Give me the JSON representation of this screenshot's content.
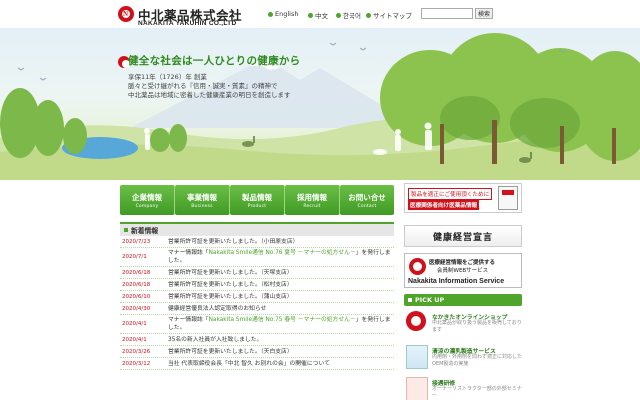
{
  "header": {
    "logo_mark": "N",
    "logo_ja": "中北薬品株式会社",
    "logo_en": "NAKAKITA YAKUHIN CO.,LTD",
    "languages": [
      "English",
      "中文",
      "한국어",
      "サイトマップ"
    ],
    "search_button": "検索",
    "accent_color": "#4fa42a",
    "brand_color": "#d0101a"
  },
  "hero": {
    "headline": "健全な社会は一人ひとりの健康から",
    "line1": "享保11年（1726）年 創業",
    "line2": "脈々と受け継がれる『信用・誠実・質素』の精神で",
    "line3": "中北薬品は地域に密着した健康産業の明日を創造します"
  },
  "nav": [
    {
      "ja": "企業情報",
      "en": "Company"
    },
    {
      "ja": "事業情報",
      "en": "Business"
    },
    {
      "ja": "製品情報",
      "en": "Product"
    },
    {
      "ja": "採用情報",
      "en": "Recruit"
    },
    {
      "ja": "お問い合せ",
      "en": "Contact"
    }
  ],
  "news": {
    "title": "新着情報",
    "items": [
      {
        "date": "2020/7/23",
        "text": "営業所許可証を更新いたしました。（小田原支店）"
      },
      {
        "date": "2020/7/1",
        "text_pre": "マナー情報誌「",
        "highlight": "Nakakita Smile通信 No.76 夏号 －マナーの処方せん－",
        "text_post": "」を発行しました。"
      },
      {
        "date": "2020/6/18",
        "text": "営業所許可証を更新いたしました。（天塚支店）"
      },
      {
        "date": "2020/6/18",
        "text": "営業所許可証を更新いたしました。（松村支店）"
      },
      {
        "date": "2020/6/10",
        "text": "営業所許可証を更新いたしました。（蒲山支店）"
      },
      {
        "date": "2020/4/30",
        "text": "健康経営優良法人認定取得のお知らせ"
      },
      {
        "date": "2020/4/1",
        "text_pre": "マナー情報誌「",
        "highlight": "Nakakita Smile通信 No.75 春号 －マナーの処方せん－",
        "text_post": "」を発行しました。"
      },
      {
        "date": "2020/4/1",
        "text": "35名の新入社員が入社致しました。"
      },
      {
        "date": "2020/3/26",
        "text": "営業所許可証を更新いたしました。（天白支店）"
      },
      {
        "date": "2020/3/12",
        "text": "当社 代表取締役会長「中北 智久 お別れの会」の開催について"
      }
    ]
  },
  "side": {
    "banner_tag1": "製品を適正にご使用頂くために",
    "banner_tag2": "医療関係者向け医薬品情報",
    "declaration": "健康経営宣言",
    "info_line1": "医療経営情報をご提供する",
    "info_line2": "会員制WEBサービス",
    "info_line3": "Nakakita Information Service",
    "pickup_title": "PICK UP",
    "pickup": [
      {
        "title": "なかきたオンラインショップ",
        "desc": "中北薬品が取り扱う製品を販売しております"
      },
      {
        "title": "清涼の濃乳製造サービス",
        "desc": "内用剤・外用剤を問わず適正に対応した OEM製造の実施"
      },
      {
        "title": "接遇研修",
        "desc": "オーナーリストラクター部の外部セミナー"
      }
    ]
  }
}
